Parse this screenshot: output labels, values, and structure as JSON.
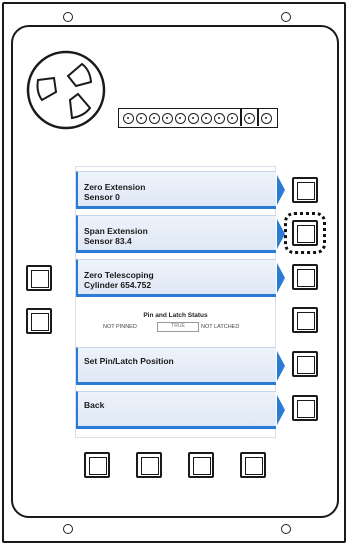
{
  "menu": [
    {
      "line1": "Zero Extension",
      "line2": "Sensor  0"
    },
    {
      "line1": "Span Extension",
      "line2": "Sensor  83.4"
    },
    {
      "line1": "Zero Telescoping",
      "line2": "Cylinder  654.752"
    },
    {
      "line1": "Set Pin/Latch Position",
      "line2": ""
    },
    {
      "line1": "Back",
      "line2": ""
    }
  ],
  "status": {
    "title": "Pin and Latch Status",
    "left": "NOT PINNED",
    "middle": "TRUE",
    "right": "NOT LATCHED"
  }
}
